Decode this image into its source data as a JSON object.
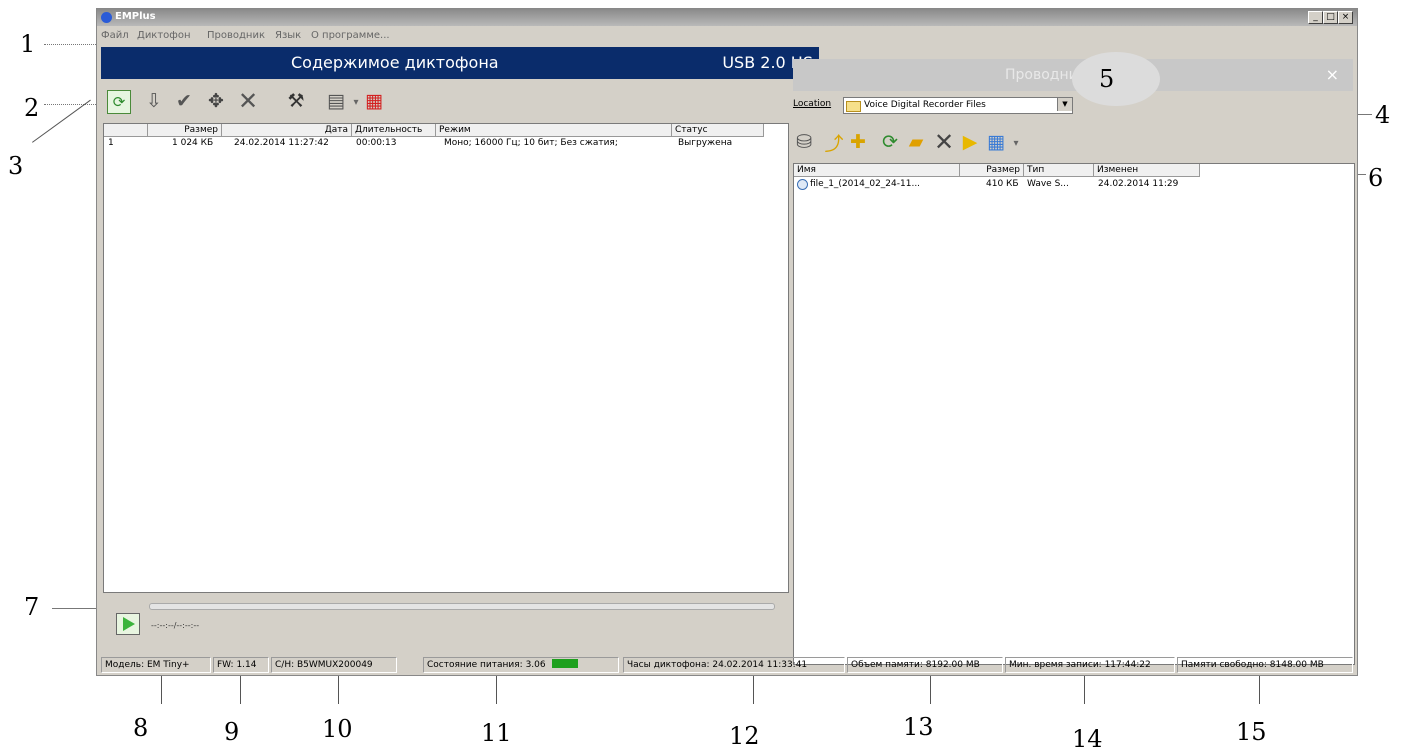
{
  "app": {
    "title": "EMPlus"
  },
  "window_controls": {
    "minimize": "_",
    "maximize": "□",
    "close": "×"
  },
  "menu": [
    "Файл",
    "Диктофон",
    "Проводник",
    "Язык",
    "О программе..."
  ],
  "left_pane": {
    "header_title": "Содержимое диктофона",
    "connection": "USB 2.0 HS",
    "toolbar_icons": [
      "refresh-icon",
      "download-icon",
      "download-check-icon",
      "move-icon",
      "delete-icon",
      "settings-icon",
      "format-icon",
      "export-icon"
    ],
    "table": {
      "columns": [
        "",
        "Размер",
        "Дата",
        "Длительность",
        "Режим",
        "Статус"
      ],
      "rows": [
        [
          "1",
          "1 024 КБ",
          "24.02.2014 11:27:42",
          "00:00:13",
          "Моно; 16000 Гц; 10 бит; Без сжатия;",
          "Выгружена"
        ]
      ]
    },
    "player": {
      "time": "--:--:--/--:--:--"
    }
  },
  "right_pane": {
    "header_title": "Проводник",
    "close": "×",
    "location_label": "Location",
    "location_value": "Voice Digital Recorder Files",
    "toolbar_icons": [
      "network-icon",
      "up-folder-icon",
      "new-folder-icon",
      "refresh-icon",
      "open-folder-icon",
      "delete-icon",
      "folder-icon",
      "view-icon"
    ],
    "table": {
      "columns": [
        "Имя",
        "Размер",
        "Тип",
        "Изменен"
      ],
      "rows": [
        [
          "file_1_(2014_02_24-11...",
          "410 КБ",
          "Wave S...",
          "24.02.2014 11:29"
        ]
      ]
    }
  },
  "status_bar": {
    "model": "Модель: EM Tiny+",
    "fw": "FW: 1.14",
    "serial": "С/Н: B5WMUX200049",
    "power": "Состояние питания: 3.06",
    "clock": "Часы диктофона: 24.02.2014 11:33:41",
    "memory": "Объем памяти: 8192.00 MB",
    "record_time": "Мин. время записи: 117:44:22",
    "free": "Памяти свободно: 8148.00 MB"
  },
  "callouts": [
    "1",
    "2",
    "3",
    "4",
    "5",
    "6",
    "7",
    "8",
    "9",
    "10",
    "11",
    "12",
    "13",
    "14",
    "15"
  ]
}
